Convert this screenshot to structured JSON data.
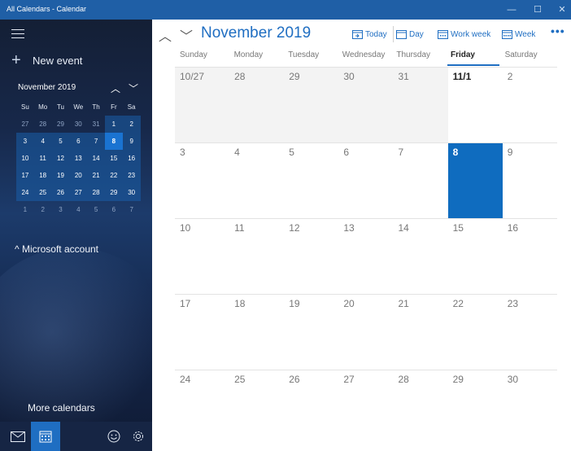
{
  "window": {
    "title": "All Calendars - Calendar",
    "minimize": "—",
    "maximize": "☐",
    "close": "✕"
  },
  "sidebar": {
    "new_event": "New event",
    "mini_month": "November 2019",
    "mini_prev": "︿",
    "mini_next": "﹀",
    "dow": [
      "Su",
      "Mo",
      "Tu",
      "We",
      "Th",
      "Fr",
      "Sa"
    ],
    "weeks": [
      [
        "27",
        "28",
        "29",
        "30",
        "31",
        "1",
        "2"
      ],
      [
        "3",
        "4",
        "5",
        "6",
        "7",
        "8",
        "9"
      ],
      [
        "10",
        "11",
        "12",
        "13",
        "14",
        "15",
        "16"
      ],
      [
        "17",
        "18",
        "19",
        "20",
        "21",
        "22",
        "23"
      ],
      [
        "24",
        "25",
        "26",
        "27",
        "28",
        "29",
        "30"
      ],
      [
        "1",
        "2",
        "3",
        "4",
        "5",
        "6",
        "7"
      ]
    ],
    "account": "^ Microsoft account",
    "more_calendars": "More calendars"
  },
  "main": {
    "month_title": "November 2019",
    "prev": "︿",
    "next": "﹀",
    "views": {
      "today": "Today",
      "day": "Day",
      "work_week": "Work week",
      "week": "Week"
    },
    "more": "•••",
    "dow": [
      "Sunday",
      "Monday",
      "Tuesday",
      "Wednesday",
      "Thursday",
      "Friday",
      "Saturday"
    ],
    "weeks": [
      [
        "10/27",
        "28",
        "29",
        "30",
        "31",
        "11/1",
        "2"
      ],
      [
        "3",
        "4",
        "5",
        "6",
        "7",
        "8",
        "9"
      ],
      [
        "10",
        "11",
        "12",
        "13",
        "14",
        "15",
        "16"
      ],
      [
        "17",
        "18",
        "19",
        "20",
        "21",
        "22",
        "23"
      ],
      [
        "24",
        "25",
        "26",
        "27",
        "28",
        "29",
        "30"
      ]
    ]
  },
  "colors": {
    "accent": "#1f6ec2",
    "titlebar": "#1f5fa6",
    "today": "#0f6cbf"
  }
}
